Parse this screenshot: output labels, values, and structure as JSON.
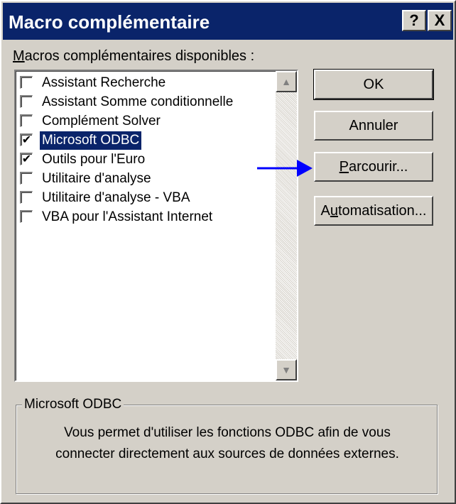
{
  "window": {
    "title": "Macro complémentaire",
    "help_button": "?",
    "close_button": "X"
  },
  "addins_list": {
    "label_hotkey": "M",
    "label_rest": "acros complémentaires disponibles :",
    "items": [
      {
        "label": "Assistant Recherche",
        "checked": false,
        "selected": false
      },
      {
        "label": "Assistant Somme conditionnelle",
        "checked": false,
        "selected": false
      },
      {
        "label": "Complément Solver",
        "checked": false,
        "selected": false
      },
      {
        "label": "Microsoft ODBC",
        "checked": true,
        "selected": true
      },
      {
        "label": "Outils pour l'Euro",
        "checked": true,
        "selected": false
      },
      {
        "label": "Utilitaire d'analyse",
        "checked": false,
        "selected": false
      },
      {
        "label": "Utilitaire d'analyse - VBA",
        "checked": false,
        "selected": false
      },
      {
        "label": "VBA pour l'Assistant Internet",
        "checked": false,
        "selected": false
      }
    ]
  },
  "buttons": {
    "ok": "OK",
    "cancel": "Annuler",
    "browse_hotkey": "P",
    "browse_rest": "arcourir...",
    "automation_before": "A",
    "automation_hotkey": "u",
    "automation_after": "tomatisation..."
  },
  "description": {
    "title": "Microsoft ODBC",
    "line1": "Vous permet d'utiliser les fonctions ODBC afin de vous",
    "line2": "connecter directement aux sources de données externes."
  },
  "colors": {
    "title_bar": "#0a246a",
    "dialog_bg": "#d4d0c8",
    "selection": "#0a246a",
    "annotation_arrow": "#0000ff"
  }
}
